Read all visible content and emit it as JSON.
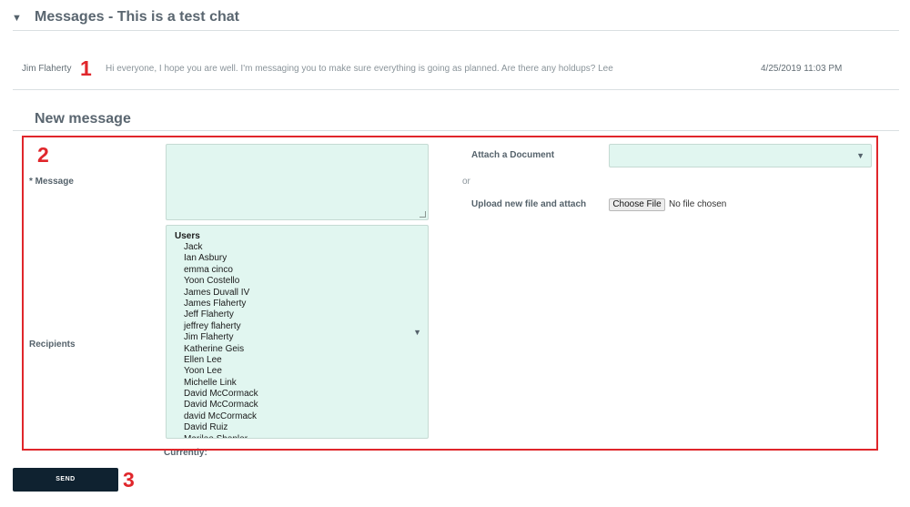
{
  "thread": {
    "collapse_icon": "triangle-down-icon",
    "title": "Messages - This is a test chat"
  },
  "message": {
    "author": "Jim Flaherty",
    "text": "Hi everyone, I hope you are well. I'm messaging you to make sure everything is going as planned. Are there any holdups? Lee",
    "date": "4/25/2019 11:03 PM"
  },
  "new_message": {
    "title": "New message",
    "message_label": "* Message",
    "recipients_label": "Recipients",
    "recipients_group": "Users",
    "users": [
      "Jack",
      "Ian Asbury",
      "emma cinco",
      "Yoon Costello",
      "James Duvall IV",
      "James Flaherty",
      "Jeff Flaherty",
      "jeffrey flaherty",
      "Jim Flaherty",
      "Katherine Geis",
      "Ellen Lee",
      "Yoon Lee",
      "Michelle Link",
      "David McCormack",
      "David McCormack",
      "david McCormack",
      "David Ruiz",
      "Marilee Shepler"
    ],
    "currently_label": "Currently:",
    "attach_label": "Attach a Document",
    "or_text": "or",
    "upload_label": "Upload new file and attach",
    "choose_file": "Choose File",
    "no_file": "No file chosen",
    "send": "SEND"
  },
  "annotations": [
    "1",
    "2",
    "3"
  ],
  "colors": {
    "field_bg": "#e1f6f0",
    "annotation_red": "#e0262b",
    "send_bg": "#0f2230"
  }
}
